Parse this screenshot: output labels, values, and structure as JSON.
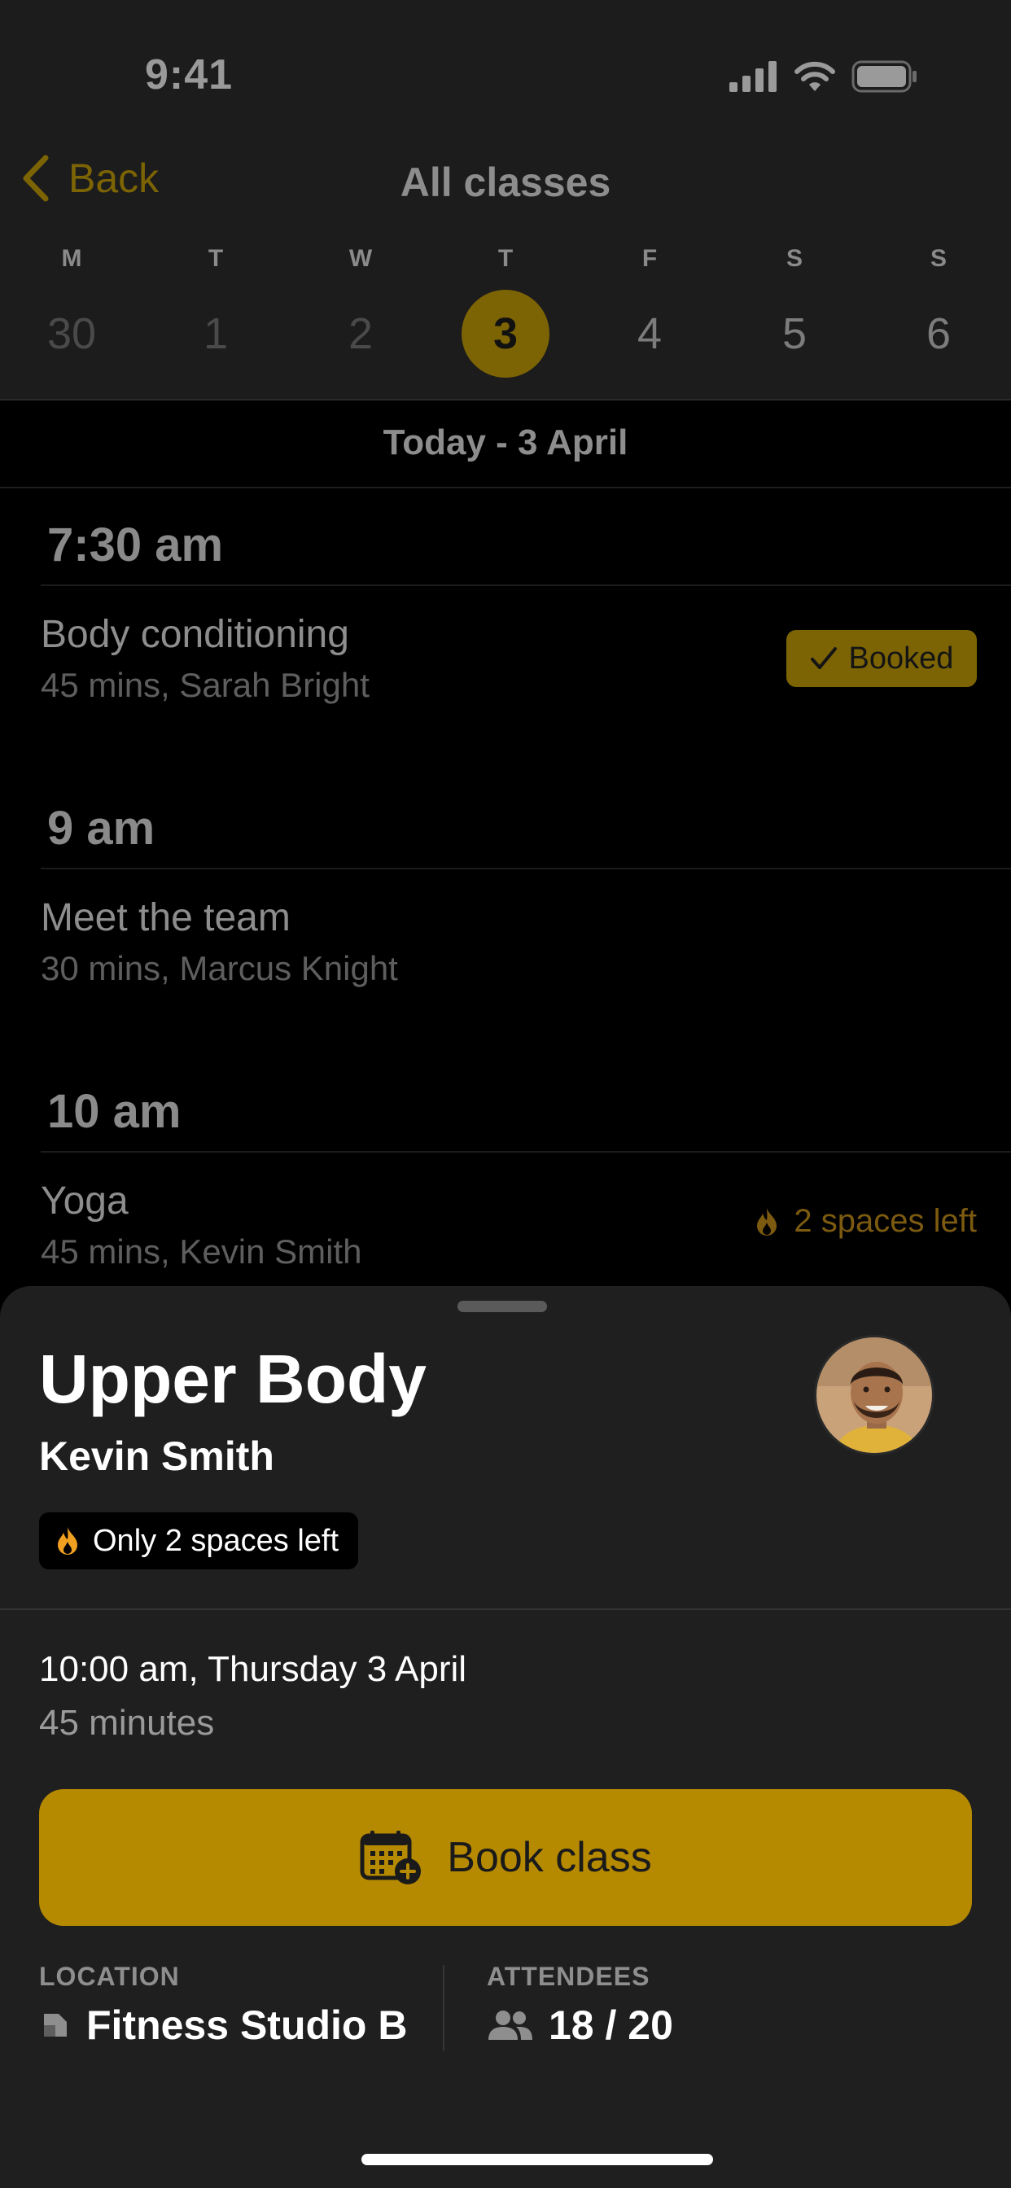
{
  "status_bar": {
    "time": "9:41"
  },
  "nav": {
    "back_label": "Back",
    "title": "All classes"
  },
  "week": [
    {
      "letter": "M",
      "num": "30",
      "state": "past"
    },
    {
      "letter": "T",
      "num": "1",
      "state": "past"
    },
    {
      "letter": "W",
      "num": "2",
      "state": "past"
    },
    {
      "letter": "T",
      "num": "3",
      "state": "selected"
    },
    {
      "letter": "F",
      "num": "4",
      "state": "future"
    },
    {
      "letter": "S",
      "num": "5",
      "state": "future"
    },
    {
      "letter": "S",
      "num": "6",
      "state": "future"
    }
  ],
  "schedule": {
    "date_header": "Today - 3 April",
    "slots": [
      {
        "time": "7:30 am",
        "class_title": "Body conditioning",
        "class_meta": "45 mins, Sarah Bright",
        "badge": "Booked"
      },
      {
        "time": "9 am",
        "class_title": "Meet the team",
        "class_meta": "30 mins, Marcus Knight"
      },
      {
        "time": "10 am",
        "class_title": "Yoga",
        "class_meta": "45 mins, Kevin Smith",
        "spaces": "2 spaces left"
      }
    ]
  },
  "sheet": {
    "title": "Upper Body",
    "instructor": "Kevin Smith",
    "availability": "Only 2 spaces left",
    "datetime": "10:00 am, Thursday 3 April",
    "duration": "45 minutes",
    "book_label": "Book class",
    "location_caption": "LOCATION",
    "location_value": "Fitness Studio B",
    "attendees_caption": "ATTENDEES",
    "attendees_value": "18 / 20"
  },
  "colors": {
    "accent": "#b58900",
    "accent_dimmed": "#7c6404",
    "sheet_bg": "#1f1f1f",
    "flame": "#f0a020"
  },
  "icons": [
    "chevron-left-icon",
    "signal-icon",
    "wifi-icon",
    "battery-icon",
    "flame-icon",
    "calendar-add-icon",
    "location-icon",
    "people-icon",
    "checkmark-icon"
  ]
}
